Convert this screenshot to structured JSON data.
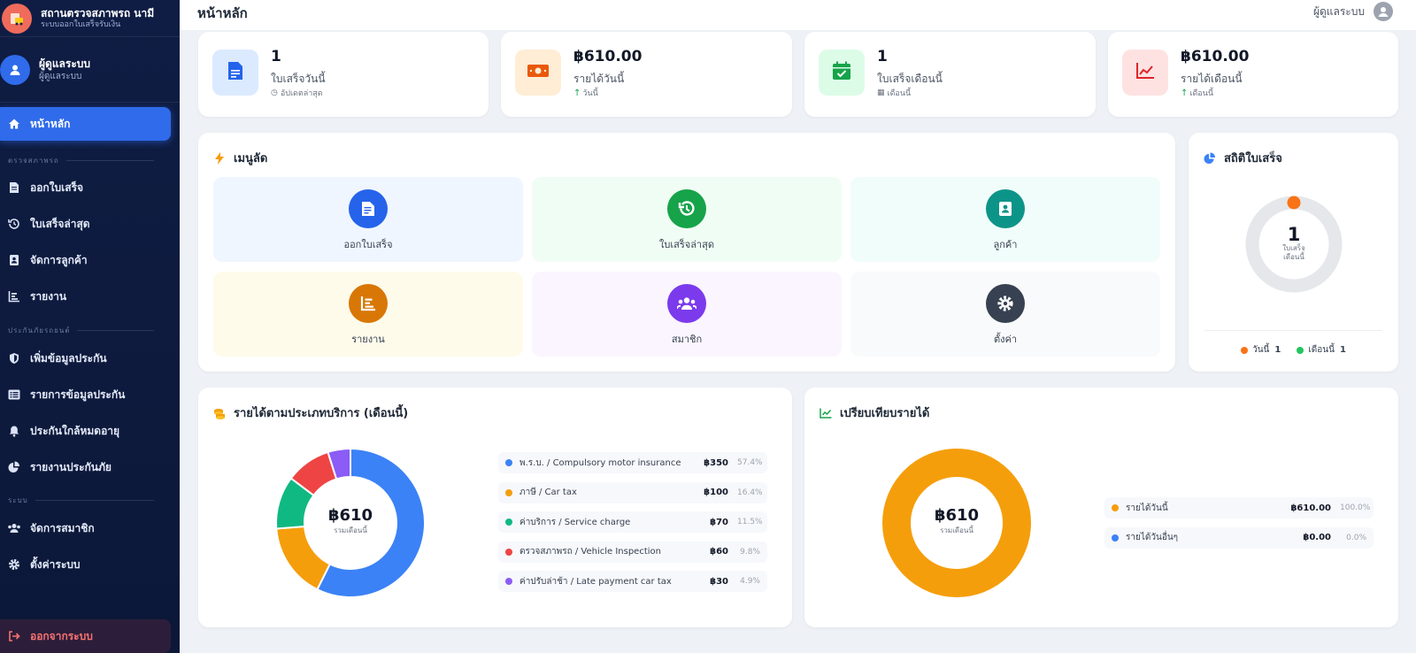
{
  "brand": {
    "title": "สถานตรวจสภาพรถ นามี",
    "subtitle": "ระบบออกใบเสร็จรับเงิน"
  },
  "user": {
    "name": "ผู้ดูแลระบบ",
    "role": "ผู้ดูแลระบบ"
  },
  "nav": {
    "home": "หน้าหลัก",
    "section_inspection": "ตรวจสภาพรถ",
    "issue_receipt": "ออกใบเสร็จ",
    "latest_receipts": "ใบเสร็จล่าสุด",
    "customers": "จัดการลูกค้า",
    "reports": "รายงาน",
    "section_insurance": "ประกันภัยรถยนต์",
    "add_insurance": "เพิ่มข้อมูลประกัน",
    "insurance_list": "รายการข้อมูลประกัน",
    "expiring": "ประกันใกล้หมดอายุ",
    "insurance_report": "รายงานประกันภัย",
    "section_system": "ระบบ",
    "members": "จัดการสมาชิก",
    "settings": "ตั้งค่าระบบ",
    "logout": "ออกจากระบบ"
  },
  "topbar": {
    "title": "หน้าหลัก",
    "user": "ผู้ดูแลระบบ"
  },
  "stats": [
    {
      "value": "1",
      "label": "ใบเสร็จวันนี้",
      "foot": "อัปเดตล่าสุด",
      "color": "#2563eb",
      "bg": "#dbeafe"
    },
    {
      "value": "฿610.00",
      "label": "รายได้วันนี้",
      "foot": "วันนี้",
      "color": "#ea580c",
      "bg": "#ffedd5"
    },
    {
      "value": "1",
      "label": "ใบเสร็จเดือนนี้",
      "foot": "เดือนนี้",
      "color": "#16a34a",
      "bg": "#dcfce7"
    },
    {
      "value": "฿610.00",
      "label": "รายได้เดือนนี้",
      "foot": "เดือนนี้",
      "color": "#dc2626",
      "bg": "#fee2e2"
    }
  ],
  "quick_menu": {
    "title": "เมนูลัด",
    "items": [
      {
        "label": "ออกใบเสร็จ",
        "icon": "receipt-icon",
        "color": "#2563eb",
        "bg": "#eff6ff"
      },
      {
        "label": "ใบเสร็จล่าสุด",
        "icon": "history-icon",
        "color": "#16a34a",
        "bg": "#f0fdf4"
      },
      {
        "label": "ลูกค้า",
        "icon": "address-book-icon",
        "color": "#0d9488",
        "bg": "#f0fdfa"
      },
      {
        "label": "รายงาน",
        "icon": "chart-bar-icon",
        "color": "#d97706",
        "bg": "#fffbeb"
      },
      {
        "label": "สมาชิก",
        "icon": "users-icon",
        "color": "#7c3aed",
        "bg": "#faf5ff"
      },
      {
        "label": "ตั้งค่า",
        "icon": "gear-icon",
        "color": "#374151",
        "bg": "#f9fafb"
      }
    ]
  },
  "receipt_stats": {
    "title": "สถิติใบเสร็จ",
    "center_value": "1",
    "center_label_1": "ใบเสร็จ",
    "center_label_2": "เดือนนี้",
    "legend_today": "วันนี้",
    "legend_today_value": "1",
    "legend_month": "เดือนนี้",
    "legend_month_value": "1",
    "colors": {
      "today": "#f97316",
      "month": "#22c55e",
      "track": "#e5e7eb"
    }
  },
  "revenue_by_service": {
    "title": "รายได้ตามประเภทบริการ (เดือนนี้)",
    "center_value": "฿610",
    "center_label": "รวมเดือนนี้"
  },
  "revenue_compare": {
    "title": "เปรียบเทียบรายได้",
    "center_value": "฿610",
    "center_label": "รวมเดือนนี้"
  },
  "chart_data": [
    {
      "type": "pie",
      "categories": [
        "พ.ร.บ. / Compulsory motor insurance",
        "ภาษี / Car tax",
        "ค่าบริการ / Service charge",
        "ตรวจสภาพรถ / Vehicle Inspection",
        "ค่าปรับล่าช้า / Late payment car tax"
      ],
      "values": [
        350,
        100,
        70,
        60,
        30
      ],
      "amount_labels": [
        "฿350",
        "฿100",
        "฿70",
        "฿60",
        "฿30"
      ],
      "percent_labels": [
        "57.4%",
        "16.4%",
        "11.5%",
        "9.8%",
        "4.9%"
      ],
      "colors": [
        "#3b82f6",
        "#f59e0b",
        "#10b981",
        "#ef4444",
        "#8b5cf6"
      ]
    },
    {
      "type": "pie",
      "categories": [
        "รายได้วันนี้",
        "รายได้วันอื่นๆ"
      ],
      "values": [
        610,
        0
      ],
      "amount_labels": [
        "฿610.00",
        "฿0.00"
      ],
      "percent_labels": [
        "100.0%",
        "0.0%"
      ],
      "colors": [
        "#f59e0b",
        "#3b82f6"
      ]
    }
  ]
}
